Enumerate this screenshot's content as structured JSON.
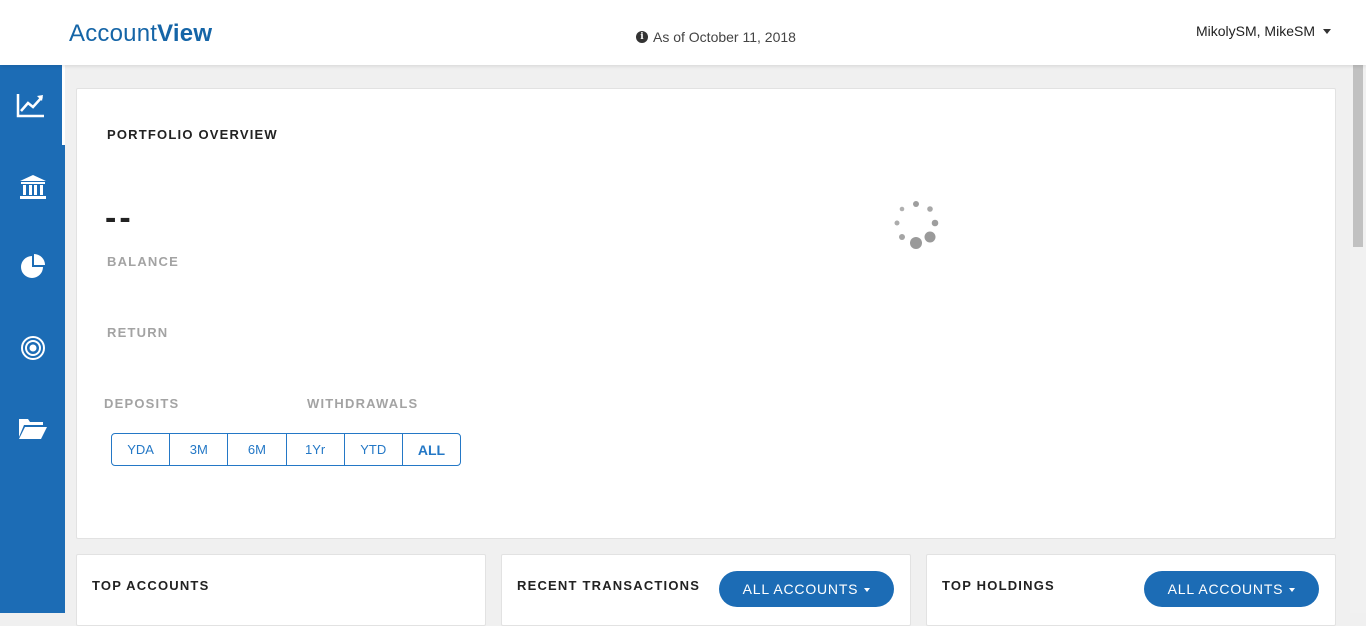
{
  "header": {
    "logo_regular": "Account",
    "logo_bold": "View",
    "as_of": "As of October 11, 2018",
    "user_name": "MikolySM, MikeSM"
  },
  "sidebar": {
    "items": [
      {
        "icon": "line-chart-icon",
        "active": true
      },
      {
        "icon": "bank-icon",
        "active": false
      },
      {
        "icon": "pie-chart-icon",
        "active": false
      },
      {
        "icon": "target-icon",
        "active": false
      },
      {
        "icon": "folder-open-icon",
        "active": false
      }
    ]
  },
  "overview": {
    "title": "PORTFOLIO OVERVIEW",
    "balance_value": "--",
    "balance_label": "BALANCE",
    "return_label": "RETURN",
    "deposits_label": "DEPOSITS",
    "withdrawals_label": "WITHDRAWALS",
    "ranges": [
      "YDA",
      "3M",
      "6M",
      "1Yr",
      "YTD",
      "ALL"
    ],
    "active_range": "ALL"
  },
  "panels": {
    "top_accounts": {
      "title": "TOP ACCOUNTS"
    },
    "recent_transactions": {
      "title": "RECENT TRANSACTIONS",
      "filter_label": "ALL ACCOUNTS"
    },
    "top_holdings": {
      "title": "TOP HOLDINGS",
      "filter_label": "ALL ACCOUNTS"
    }
  },
  "colors": {
    "brand_blue": "#1c6cb5",
    "accent_blue": "#2478c6",
    "background": "#f0f0f0"
  }
}
